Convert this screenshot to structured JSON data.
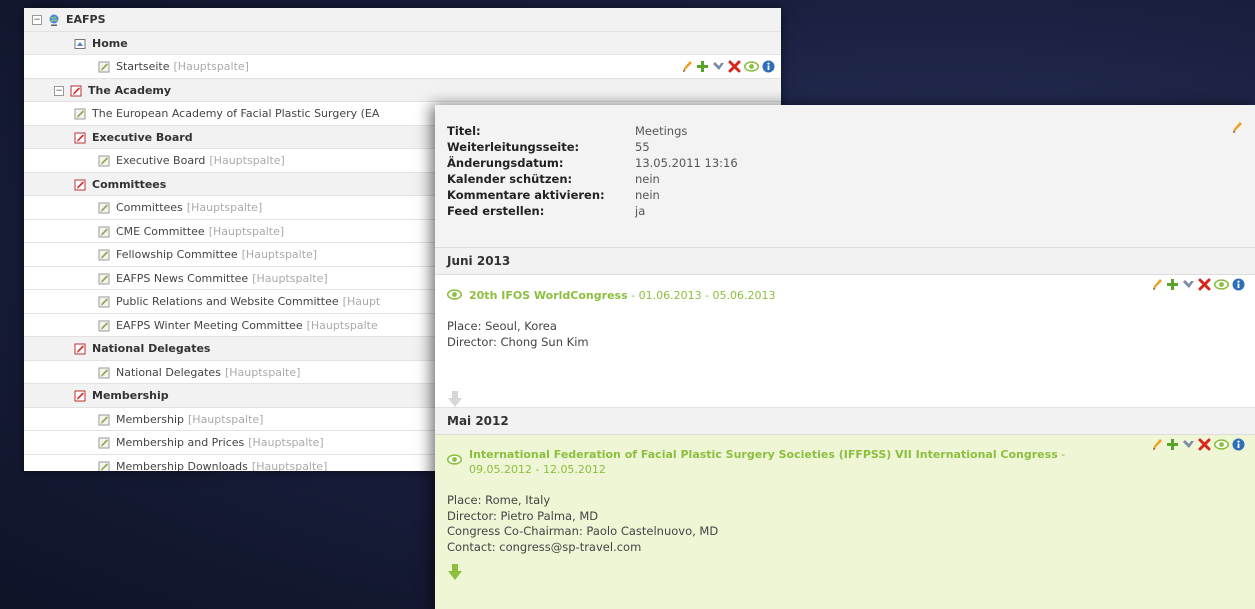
{
  "tree": {
    "rows": [
      {
        "label": "EAFPS",
        "column": "",
        "type": "root",
        "level": 0,
        "toggle": "−"
      },
      {
        "label": "Home",
        "column": "",
        "type": "section",
        "level": 2
      },
      {
        "label": "Startseite",
        "column": "[Hauptspalte]",
        "type": "page",
        "level": 3,
        "actions": true
      },
      {
        "label": "The Academy",
        "column": "",
        "type": "section",
        "level": 1,
        "toggle": "−"
      },
      {
        "label": "The European Academy of Facial Plastic Surgery (EA",
        "column": "",
        "type": "page",
        "level": 2
      },
      {
        "label": "Executive Board",
        "column": "",
        "type": "section",
        "level": 2
      },
      {
        "label": "Executive Board",
        "column": "[Hauptspalte]",
        "type": "page",
        "level": 3
      },
      {
        "label": "Committees",
        "column": "",
        "type": "section",
        "level": 2
      },
      {
        "label": "Committees",
        "column": "[Hauptspalte]",
        "type": "page",
        "level": 3
      },
      {
        "label": "CME Committee",
        "column": "[Hauptspalte]",
        "type": "page",
        "level": 3
      },
      {
        "label": "Fellowship Committee",
        "column": "[Hauptspalte]",
        "type": "page",
        "level": 3
      },
      {
        "label": "EAFPS News Committee",
        "column": "[Hauptspalte]",
        "type": "page",
        "level": 3
      },
      {
        "label": "Public Relations and Website Committee",
        "column": "[Haupt",
        "type": "page",
        "level": 3
      },
      {
        "label": "EAFPS Winter Meeting Committee",
        "column": "[Hauptspalte",
        "type": "page",
        "level": 3
      },
      {
        "label": "National Delegates",
        "column": "",
        "type": "section",
        "level": 2
      },
      {
        "label": "National Delegates",
        "column": "[Hauptspalte]",
        "type": "page",
        "level": 3
      },
      {
        "label": "Membership",
        "column": "",
        "type": "section",
        "level": 2
      },
      {
        "label": "Membership",
        "column": "[Hauptspalte]",
        "type": "page",
        "level": 3
      },
      {
        "label": "Membership and Prices",
        "column": "[Hauptspalte]",
        "type": "page",
        "level": 3
      },
      {
        "label": "Membership Downloads",
        "column": "[Hauptspalte]",
        "type": "page",
        "level": 3
      }
    ]
  },
  "detail": {
    "properties": [
      {
        "label": "Titel:",
        "value": "Meetings"
      },
      {
        "label": "Weiterleitungsseite:",
        "value": "55"
      },
      {
        "label": "Änderungsdatum:",
        "value": "13.05.2011 13:16"
      },
      {
        "label": "Kalender schützen:",
        "value": "nein"
      },
      {
        "label": "Kommentare aktivieren:",
        "value": "nein"
      },
      {
        "label": "Feed erstellen:",
        "value": "ja"
      }
    ],
    "groups": [
      {
        "month": "Juni 2013",
        "event": {
          "title": "20th IFOS WorldCongress",
          "date": " - 01.06.2013 - 05.06.2013",
          "lines": [
            "Place: Seoul, Korea",
            "Director: Chong Sun Kim"
          ]
        }
      },
      {
        "month": "Mai 2012",
        "event": {
          "title": "International Federation of Facial Plastic Surgery Societies (IFFPSS) VII International Congress",
          "date": " - 09.05.2012 - 12.05.2012",
          "lines": [
            "Place: Rome, Italy",
            "Director: Pietro Palma, MD",
            "Congress Co-Chairman: Paolo Castelnuovo, MD",
            "Contact: congress@sp-travel.com"
          ]
        }
      }
    ]
  },
  "icons": {
    "edit": "pencil-icon",
    "add": "plus-icon",
    "move": "move-icon",
    "delete": "delete-icon",
    "preview": "eye-icon",
    "info": "info-icon",
    "down": "arrow-down-icon"
  },
  "colors": {
    "accent_green": "#8cbf3f",
    "highlight_bg": "#eef6d6",
    "delete_red": "#d8261c",
    "info_blue": "#2f6fb8",
    "pencil_orange": "#f0a01e"
  }
}
